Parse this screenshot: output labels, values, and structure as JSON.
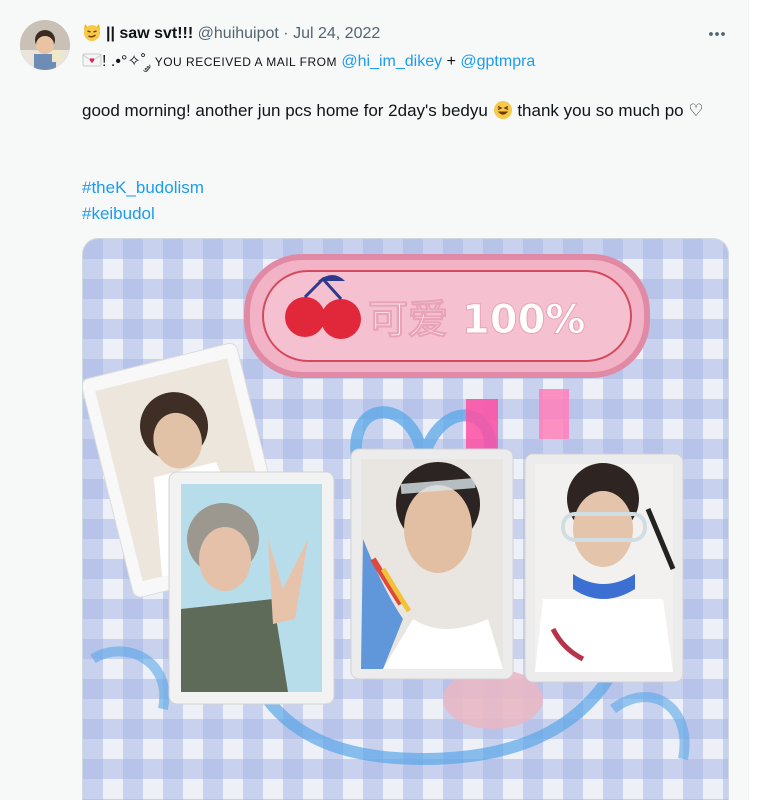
{
  "tweet": {
    "display_name": "|| saw svt!!!",
    "handle": "@huihuipot",
    "separator": "·",
    "date": "Jul 24, 2022",
    "more_label": "•••",
    "bio_prefix": "! .•°✧˚ ༘",
    "bio_text": "YOU RECEIVED A MAIL FROM",
    "mention_1": "@hi_im_dikey",
    "plus": "+",
    "mention_2": "@gptmpra",
    "text_part1": "good morning! another jun pcs home for 2day's bedyu",
    "text_part2": "thank  you so much po ♡",
    "hashtags": [
      "#theK_budolism",
      "#keibudol"
    ]
  },
  "photo": {
    "sticker_text": "可爱 100%"
  },
  "colors": {
    "link": "#1d9bf0",
    "muted": "#536471",
    "background": "#f7f9f9"
  }
}
